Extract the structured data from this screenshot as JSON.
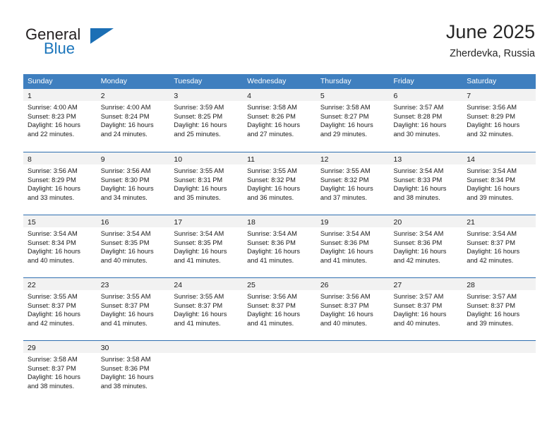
{
  "brand": {
    "word1": "General",
    "word2": "Blue",
    "logo_icon": "blue-triangle-icon"
  },
  "header": {
    "title": "June 2025",
    "subtitle": "Zherdevka, Russia"
  },
  "colors": {
    "header_blue": "#3f7fbf",
    "row_border_blue": "#2f6fb0",
    "day_band_gray": "#f2f2f2",
    "brand_blue": "#1b75bb"
  },
  "weekday_headers": [
    "Sunday",
    "Monday",
    "Tuesday",
    "Wednesday",
    "Thursday",
    "Friday",
    "Saturday"
  ],
  "weeks": [
    [
      {
        "day": "1",
        "sunrise": "Sunrise: 4:00 AM",
        "sunset": "Sunset: 8:23 PM",
        "daylight1": "Daylight: 16 hours",
        "daylight2": "and 22 minutes."
      },
      {
        "day": "2",
        "sunrise": "Sunrise: 4:00 AM",
        "sunset": "Sunset: 8:24 PM",
        "daylight1": "Daylight: 16 hours",
        "daylight2": "and 24 minutes."
      },
      {
        "day": "3",
        "sunrise": "Sunrise: 3:59 AM",
        "sunset": "Sunset: 8:25 PM",
        "daylight1": "Daylight: 16 hours",
        "daylight2": "and 25 minutes."
      },
      {
        "day": "4",
        "sunrise": "Sunrise: 3:58 AM",
        "sunset": "Sunset: 8:26 PM",
        "daylight1": "Daylight: 16 hours",
        "daylight2": "and 27 minutes."
      },
      {
        "day": "5",
        "sunrise": "Sunrise: 3:58 AM",
        "sunset": "Sunset: 8:27 PM",
        "daylight1": "Daylight: 16 hours",
        "daylight2": "and 29 minutes."
      },
      {
        "day": "6",
        "sunrise": "Sunrise: 3:57 AM",
        "sunset": "Sunset: 8:28 PM",
        "daylight1": "Daylight: 16 hours",
        "daylight2": "and 30 minutes."
      },
      {
        "day": "7",
        "sunrise": "Sunrise: 3:56 AM",
        "sunset": "Sunset: 8:29 PM",
        "daylight1": "Daylight: 16 hours",
        "daylight2": "and 32 minutes."
      }
    ],
    [
      {
        "day": "8",
        "sunrise": "Sunrise: 3:56 AM",
        "sunset": "Sunset: 8:29 PM",
        "daylight1": "Daylight: 16 hours",
        "daylight2": "and 33 minutes."
      },
      {
        "day": "9",
        "sunrise": "Sunrise: 3:56 AM",
        "sunset": "Sunset: 8:30 PM",
        "daylight1": "Daylight: 16 hours",
        "daylight2": "and 34 minutes."
      },
      {
        "day": "10",
        "sunrise": "Sunrise: 3:55 AM",
        "sunset": "Sunset: 8:31 PM",
        "daylight1": "Daylight: 16 hours",
        "daylight2": "and 35 minutes."
      },
      {
        "day": "11",
        "sunrise": "Sunrise: 3:55 AM",
        "sunset": "Sunset: 8:32 PM",
        "daylight1": "Daylight: 16 hours",
        "daylight2": "and 36 minutes."
      },
      {
        "day": "12",
        "sunrise": "Sunrise: 3:55 AM",
        "sunset": "Sunset: 8:32 PM",
        "daylight1": "Daylight: 16 hours",
        "daylight2": "and 37 minutes."
      },
      {
        "day": "13",
        "sunrise": "Sunrise: 3:54 AM",
        "sunset": "Sunset: 8:33 PM",
        "daylight1": "Daylight: 16 hours",
        "daylight2": "and 38 minutes."
      },
      {
        "day": "14",
        "sunrise": "Sunrise: 3:54 AM",
        "sunset": "Sunset: 8:34 PM",
        "daylight1": "Daylight: 16 hours",
        "daylight2": "and 39 minutes."
      }
    ],
    [
      {
        "day": "15",
        "sunrise": "Sunrise: 3:54 AM",
        "sunset": "Sunset: 8:34 PM",
        "daylight1": "Daylight: 16 hours",
        "daylight2": "and 40 minutes."
      },
      {
        "day": "16",
        "sunrise": "Sunrise: 3:54 AM",
        "sunset": "Sunset: 8:35 PM",
        "daylight1": "Daylight: 16 hours",
        "daylight2": "and 40 minutes."
      },
      {
        "day": "17",
        "sunrise": "Sunrise: 3:54 AM",
        "sunset": "Sunset: 8:35 PM",
        "daylight1": "Daylight: 16 hours",
        "daylight2": "and 41 minutes."
      },
      {
        "day": "18",
        "sunrise": "Sunrise: 3:54 AM",
        "sunset": "Sunset: 8:36 PM",
        "daylight1": "Daylight: 16 hours",
        "daylight2": "and 41 minutes."
      },
      {
        "day": "19",
        "sunrise": "Sunrise: 3:54 AM",
        "sunset": "Sunset: 8:36 PM",
        "daylight1": "Daylight: 16 hours",
        "daylight2": "and 41 minutes."
      },
      {
        "day": "20",
        "sunrise": "Sunrise: 3:54 AM",
        "sunset": "Sunset: 8:36 PM",
        "daylight1": "Daylight: 16 hours",
        "daylight2": "and 42 minutes."
      },
      {
        "day": "21",
        "sunrise": "Sunrise: 3:54 AM",
        "sunset": "Sunset: 8:37 PM",
        "daylight1": "Daylight: 16 hours",
        "daylight2": "and 42 minutes."
      }
    ],
    [
      {
        "day": "22",
        "sunrise": "Sunrise: 3:55 AM",
        "sunset": "Sunset: 8:37 PM",
        "daylight1": "Daylight: 16 hours",
        "daylight2": "and 42 minutes."
      },
      {
        "day": "23",
        "sunrise": "Sunrise: 3:55 AM",
        "sunset": "Sunset: 8:37 PM",
        "daylight1": "Daylight: 16 hours",
        "daylight2": "and 41 minutes."
      },
      {
        "day": "24",
        "sunrise": "Sunrise: 3:55 AM",
        "sunset": "Sunset: 8:37 PM",
        "daylight1": "Daylight: 16 hours",
        "daylight2": "and 41 minutes."
      },
      {
        "day": "25",
        "sunrise": "Sunrise: 3:56 AM",
        "sunset": "Sunset: 8:37 PM",
        "daylight1": "Daylight: 16 hours",
        "daylight2": "and 41 minutes."
      },
      {
        "day": "26",
        "sunrise": "Sunrise: 3:56 AM",
        "sunset": "Sunset: 8:37 PM",
        "daylight1": "Daylight: 16 hours",
        "daylight2": "and 40 minutes."
      },
      {
        "day": "27",
        "sunrise": "Sunrise: 3:57 AM",
        "sunset": "Sunset: 8:37 PM",
        "daylight1": "Daylight: 16 hours",
        "daylight2": "and 40 minutes."
      },
      {
        "day": "28",
        "sunrise": "Sunrise: 3:57 AM",
        "sunset": "Sunset: 8:37 PM",
        "daylight1": "Daylight: 16 hours",
        "daylight2": "and 39 minutes."
      }
    ],
    [
      {
        "day": "29",
        "sunrise": "Sunrise: 3:58 AM",
        "sunset": "Sunset: 8:37 PM",
        "daylight1": "Daylight: 16 hours",
        "daylight2": "and 38 minutes."
      },
      {
        "day": "30",
        "sunrise": "Sunrise: 3:58 AM",
        "sunset": "Sunset: 8:36 PM",
        "daylight1": "Daylight: 16 hours",
        "daylight2": "and 38 minutes."
      },
      {
        "day": "",
        "sunrise": "",
        "sunset": "",
        "daylight1": "",
        "daylight2": "",
        "empty": true
      },
      {
        "day": "",
        "sunrise": "",
        "sunset": "",
        "daylight1": "",
        "daylight2": "",
        "empty": true
      },
      {
        "day": "",
        "sunrise": "",
        "sunset": "",
        "daylight1": "",
        "daylight2": "",
        "empty": true
      },
      {
        "day": "",
        "sunrise": "",
        "sunset": "",
        "daylight1": "",
        "daylight2": "",
        "empty": true
      },
      {
        "day": "",
        "sunrise": "",
        "sunset": "",
        "daylight1": "",
        "daylight2": "",
        "empty": true
      }
    ]
  ]
}
